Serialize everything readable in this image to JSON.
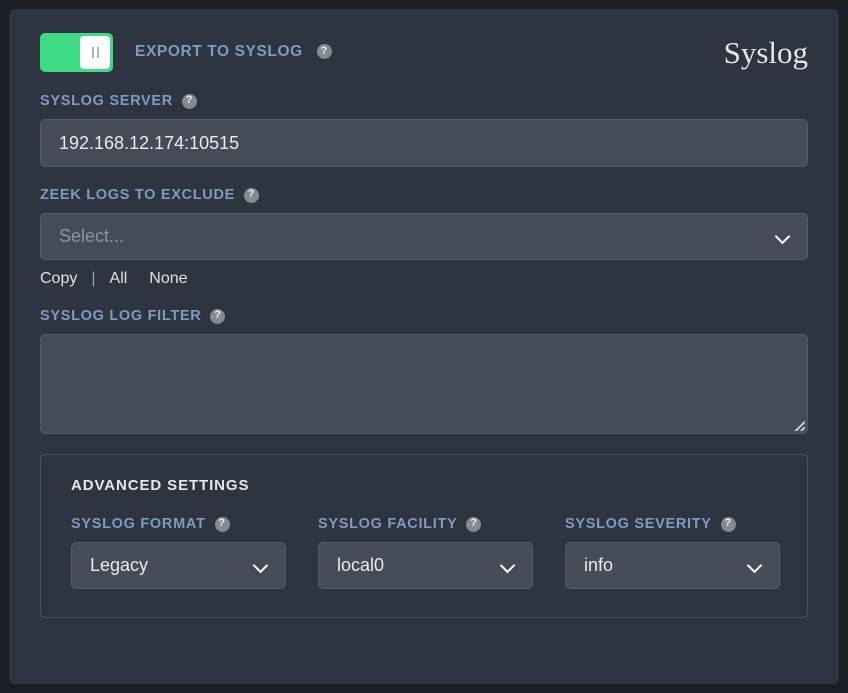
{
  "page": {
    "title": "Syslog"
  },
  "toggle": {
    "label": "Export to Syslog",
    "state": "on",
    "knob_icon": "pause-bars-icon",
    "color_on": "#3ddc84"
  },
  "help_icon": "?",
  "fields": {
    "syslog_server": {
      "label": "Syslog Server",
      "value": "192.168.12.174:10515",
      "placeholder": ""
    },
    "zeek_logs_exclude": {
      "label": "Zeek Logs to Exclude",
      "value": "",
      "placeholder": "Select...",
      "chevron": "chevron-down-icon"
    },
    "syslog_log_filter": {
      "label": "Syslog Log Filter",
      "value": "",
      "placeholder": ""
    }
  },
  "selection_links": {
    "copy": "Copy",
    "separator": "|",
    "all": "All",
    "none": "None"
  },
  "advanced": {
    "title": "Advanced Settings",
    "syslog_format": {
      "label": "Syslog Format",
      "value": "Legacy"
    },
    "syslog_facility": {
      "label": "Syslog Facility",
      "value": "local0"
    },
    "syslog_severity": {
      "label": "Syslog Severity",
      "value": "info"
    }
  },
  "colors": {
    "background": "#1b1e24",
    "card": "#2e3440",
    "label": "#7f9bbf",
    "input": "#454c57",
    "accent_green": "#3ddc84"
  }
}
